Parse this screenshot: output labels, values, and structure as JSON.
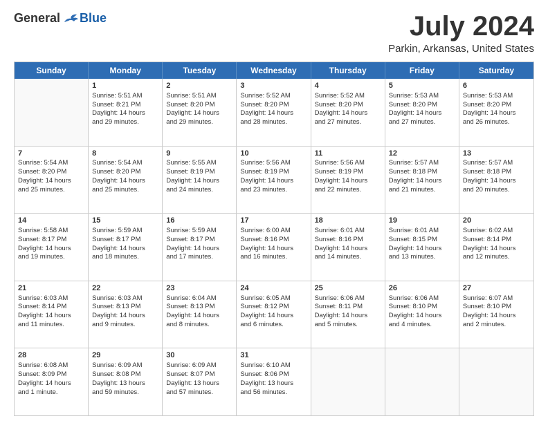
{
  "logo": {
    "general": "General",
    "blue": "Blue"
  },
  "title": "July 2024",
  "subtitle": "Parkin, Arkansas, United States",
  "days": [
    "Sunday",
    "Monday",
    "Tuesday",
    "Wednesday",
    "Thursday",
    "Friday",
    "Saturday"
  ],
  "weeks": [
    [
      {
        "day": "",
        "info": ""
      },
      {
        "day": "1",
        "info": "Sunrise: 5:51 AM\nSunset: 8:21 PM\nDaylight: 14 hours\nand 29 minutes."
      },
      {
        "day": "2",
        "info": "Sunrise: 5:51 AM\nSunset: 8:20 PM\nDaylight: 14 hours\nand 29 minutes."
      },
      {
        "day": "3",
        "info": "Sunrise: 5:52 AM\nSunset: 8:20 PM\nDaylight: 14 hours\nand 28 minutes."
      },
      {
        "day": "4",
        "info": "Sunrise: 5:52 AM\nSunset: 8:20 PM\nDaylight: 14 hours\nand 27 minutes."
      },
      {
        "day": "5",
        "info": "Sunrise: 5:53 AM\nSunset: 8:20 PM\nDaylight: 14 hours\nand 27 minutes."
      },
      {
        "day": "6",
        "info": "Sunrise: 5:53 AM\nSunset: 8:20 PM\nDaylight: 14 hours\nand 26 minutes."
      }
    ],
    [
      {
        "day": "7",
        "info": "Sunrise: 5:54 AM\nSunset: 8:20 PM\nDaylight: 14 hours\nand 25 minutes."
      },
      {
        "day": "8",
        "info": "Sunrise: 5:54 AM\nSunset: 8:20 PM\nDaylight: 14 hours\nand 25 minutes."
      },
      {
        "day": "9",
        "info": "Sunrise: 5:55 AM\nSunset: 8:19 PM\nDaylight: 14 hours\nand 24 minutes."
      },
      {
        "day": "10",
        "info": "Sunrise: 5:56 AM\nSunset: 8:19 PM\nDaylight: 14 hours\nand 23 minutes."
      },
      {
        "day": "11",
        "info": "Sunrise: 5:56 AM\nSunset: 8:19 PM\nDaylight: 14 hours\nand 22 minutes."
      },
      {
        "day": "12",
        "info": "Sunrise: 5:57 AM\nSunset: 8:18 PM\nDaylight: 14 hours\nand 21 minutes."
      },
      {
        "day": "13",
        "info": "Sunrise: 5:57 AM\nSunset: 8:18 PM\nDaylight: 14 hours\nand 20 minutes."
      }
    ],
    [
      {
        "day": "14",
        "info": "Sunrise: 5:58 AM\nSunset: 8:17 PM\nDaylight: 14 hours\nand 19 minutes."
      },
      {
        "day": "15",
        "info": "Sunrise: 5:59 AM\nSunset: 8:17 PM\nDaylight: 14 hours\nand 18 minutes."
      },
      {
        "day": "16",
        "info": "Sunrise: 5:59 AM\nSunset: 8:17 PM\nDaylight: 14 hours\nand 17 minutes."
      },
      {
        "day": "17",
        "info": "Sunrise: 6:00 AM\nSunset: 8:16 PM\nDaylight: 14 hours\nand 16 minutes."
      },
      {
        "day": "18",
        "info": "Sunrise: 6:01 AM\nSunset: 8:16 PM\nDaylight: 14 hours\nand 14 minutes."
      },
      {
        "day": "19",
        "info": "Sunrise: 6:01 AM\nSunset: 8:15 PM\nDaylight: 14 hours\nand 13 minutes."
      },
      {
        "day": "20",
        "info": "Sunrise: 6:02 AM\nSunset: 8:14 PM\nDaylight: 14 hours\nand 12 minutes."
      }
    ],
    [
      {
        "day": "21",
        "info": "Sunrise: 6:03 AM\nSunset: 8:14 PM\nDaylight: 14 hours\nand 11 minutes."
      },
      {
        "day": "22",
        "info": "Sunrise: 6:03 AM\nSunset: 8:13 PM\nDaylight: 14 hours\nand 9 minutes."
      },
      {
        "day": "23",
        "info": "Sunrise: 6:04 AM\nSunset: 8:13 PM\nDaylight: 14 hours\nand 8 minutes."
      },
      {
        "day": "24",
        "info": "Sunrise: 6:05 AM\nSunset: 8:12 PM\nDaylight: 14 hours\nand 6 minutes."
      },
      {
        "day": "25",
        "info": "Sunrise: 6:06 AM\nSunset: 8:11 PM\nDaylight: 14 hours\nand 5 minutes."
      },
      {
        "day": "26",
        "info": "Sunrise: 6:06 AM\nSunset: 8:10 PM\nDaylight: 14 hours\nand 4 minutes."
      },
      {
        "day": "27",
        "info": "Sunrise: 6:07 AM\nSunset: 8:10 PM\nDaylight: 14 hours\nand 2 minutes."
      }
    ],
    [
      {
        "day": "28",
        "info": "Sunrise: 6:08 AM\nSunset: 8:09 PM\nDaylight: 14 hours\nand 1 minute."
      },
      {
        "day": "29",
        "info": "Sunrise: 6:09 AM\nSunset: 8:08 PM\nDaylight: 13 hours\nand 59 minutes."
      },
      {
        "day": "30",
        "info": "Sunrise: 6:09 AM\nSunset: 8:07 PM\nDaylight: 13 hours\nand 57 minutes."
      },
      {
        "day": "31",
        "info": "Sunrise: 6:10 AM\nSunset: 8:06 PM\nDaylight: 13 hours\nand 56 minutes."
      },
      {
        "day": "",
        "info": ""
      },
      {
        "day": "",
        "info": ""
      },
      {
        "day": "",
        "info": ""
      }
    ]
  ]
}
